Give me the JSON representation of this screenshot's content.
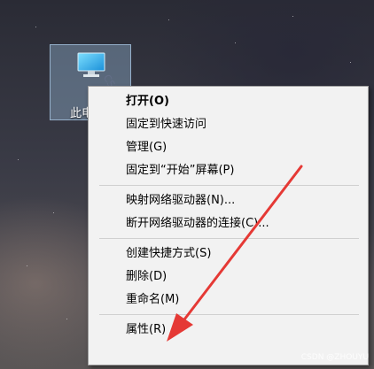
{
  "desktop": {
    "icon_label": "此电脑"
  },
  "context_menu": {
    "groups": [
      [
        "打开(O)",
        "固定到快速访问",
        "管理(G)",
        "固定到“开始”屏幕(P)"
      ],
      [
        "映射网络驱动器(N)...",
        "断开网络驱动器的连接(C)..."
      ],
      [
        "创建快捷方式(S)",
        "删除(D)",
        "重命名(M)"
      ],
      [
        "属性(R)"
      ]
    ]
  },
  "watermark": "CSDN @ZHOUYU",
  "credit": "CSDN @ZHOUYU",
  "colors": {
    "arrow": "#e53935",
    "menu_background": "#f2f2f2",
    "selection": "#8caac8"
  }
}
